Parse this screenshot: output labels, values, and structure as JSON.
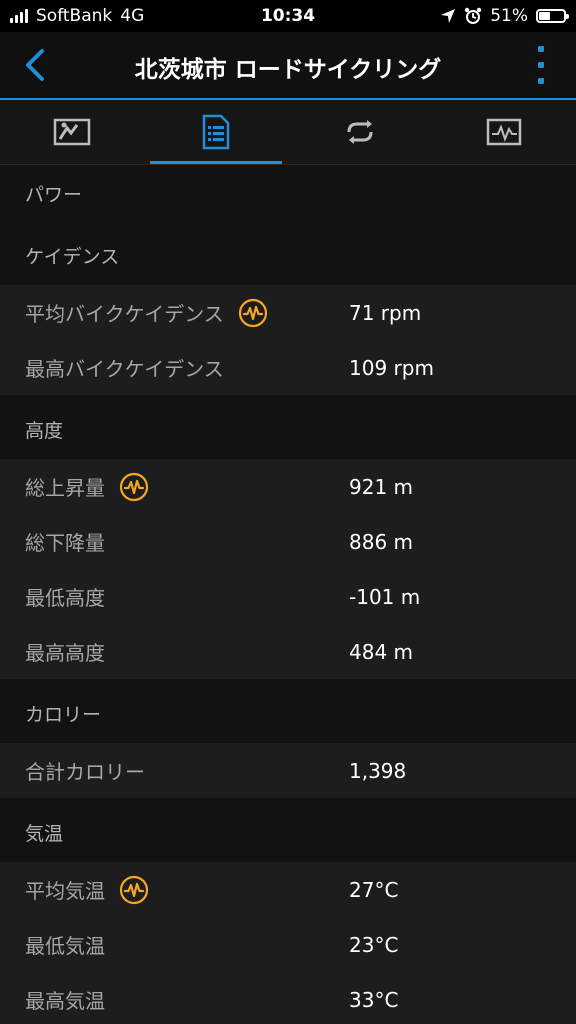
{
  "status_bar": {
    "carrier": "SoftBank",
    "network": "4G",
    "time": "10:34",
    "battery": "51%",
    "battery_level": 0.51
  },
  "header": {
    "title": "北茨城市 ロードサイクリング",
    "accent_color": "#1f8fd6"
  },
  "tabs": [
    {
      "name": "map-tab",
      "icon": "map-icon",
      "active": false
    },
    {
      "name": "stats-tab",
      "icon": "document-list-icon",
      "active": true
    },
    {
      "name": "laps-tab",
      "icon": "loop-icon",
      "active": false
    },
    {
      "name": "charts-tab",
      "icon": "chart-icon",
      "active": false
    }
  ],
  "sections": {
    "power": {
      "title": "パワー"
    },
    "cadence": {
      "title": "ケイデンス",
      "rows": [
        {
          "label": "平均バイクケイデンス",
          "value": "71 rpm",
          "has_chart": true
        },
        {
          "label": "最高バイクケイデンス",
          "value": "109 rpm",
          "has_chart": false
        }
      ]
    },
    "elevation": {
      "title": "高度",
      "rows": [
        {
          "label": "総上昇量",
          "value": "921 m",
          "has_chart": true
        },
        {
          "label": "総下降量",
          "value": "886 m",
          "has_chart": false
        },
        {
          "label": "最低高度",
          "value": "-101 m",
          "has_chart": false
        },
        {
          "label": "最高高度",
          "value": "484 m",
          "has_chart": false
        }
      ]
    },
    "calories": {
      "title": "カロリー",
      "rows": [
        {
          "label": "合計カロリー",
          "value": "1,398",
          "has_chart": false
        }
      ]
    },
    "temperature": {
      "title": "気温",
      "rows": [
        {
          "label": "平均気温",
          "value": "27°C",
          "has_chart": true
        },
        {
          "label": "最低気温",
          "value": "23°C",
          "has_chart": false
        },
        {
          "label": "最高気温",
          "value": "33°C",
          "has_chart": false
        }
      ]
    }
  },
  "colors": {
    "chart_badge": "#f5a623",
    "tab_icon": "#bdbdbd",
    "tab_active": "#1f8fd6"
  }
}
